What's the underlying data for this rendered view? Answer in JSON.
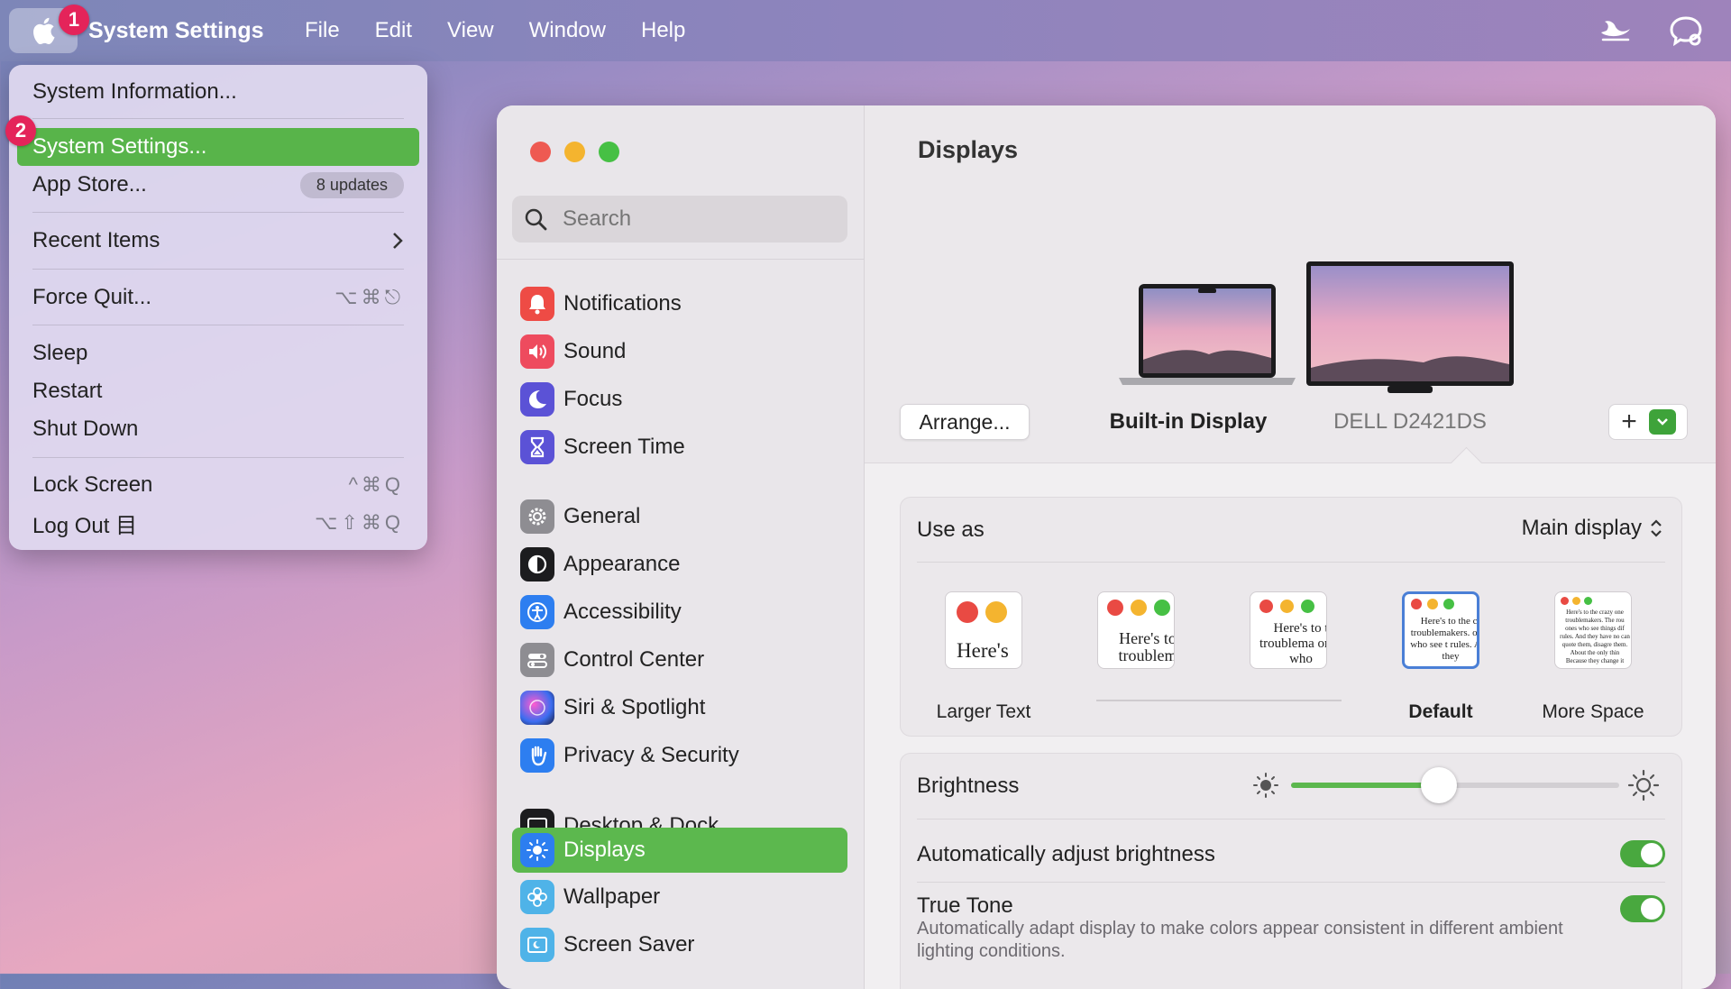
{
  "menubar": {
    "app_name": "System Settings",
    "menus": [
      "File",
      "Edit",
      "View",
      "Window",
      "Help"
    ]
  },
  "badges": {
    "apple": "1",
    "settings": "2"
  },
  "apple_menu": {
    "system_information": "System Information...",
    "system_settings": "System Settings...",
    "app_store": "App Store...",
    "app_store_badge": "8 updates",
    "recent_items": "Recent Items",
    "force_quit": "Force Quit...",
    "force_quit_shortcut": "⌥⌘⎋",
    "sleep": "Sleep",
    "restart": "Restart",
    "shut_down": "Shut Down",
    "lock_screen": "Lock Screen",
    "lock_screen_shortcut": "^⌘Q",
    "log_out": "Log Out 目",
    "log_out_shortcut": "⌥⇧⌘Q"
  },
  "sidebar": {
    "search_placeholder": "Search",
    "items": [
      {
        "label": "Notifications",
        "icon": "bell-icon",
        "color": "#ee4b45"
      },
      {
        "label": "Sound",
        "icon": "speaker-icon",
        "color": "#ee4b5e"
      },
      {
        "label": "Focus",
        "icon": "moon-icon",
        "color": "#5b52d6"
      },
      {
        "label": "Screen Time",
        "icon": "hourglass-icon",
        "color": "#5b52d6"
      },
      {
        "label": "General",
        "icon": "gear-icon",
        "color": "#8e8d92"
      },
      {
        "label": "Appearance",
        "icon": "appearance-icon",
        "color": "#1c1c1e"
      },
      {
        "label": "Accessibility",
        "icon": "accessibility-icon",
        "color": "#2d7ef0"
      },
      {
        "label": "Control Center",
        "icon": "control-center-icon",
        "color": "#8e8d92"
      },
      {
        "label": "Siri & Spotlight",
        "icon": "siri-icon",
        "color": "#7a3bd1"
      },
      {
        "label": "Privacy & Security",
        "icon": "hand-icon",
        "color": "#2d7ef0"
      },
      {
        "label": "Desktop & Dock",
        "icon": "dock-icon",
        "color": "#1c1c1e"
      },
      {
        "label": "Displays",
        "icon": "sun-icon",
        "color": "#2d7ef0"
      },
      {
        "label": "Wallpaper",
        "icon": "flower-icon",
        "color": "#4fb3e8"
      },
      {
        "label": "Screen Saver",
        "icon": "screen-saver-icon",
        "color": "#4fb3e8"
      }
    ]
  },
  "displays": {
    "title": "Displays",
    "arrange_label": "Arrange...",
    "builtin_label": "Built-in Display",
    "external_label": "DELL D2421DS",
    "add_label": "+",
    "use_as_label": "Use as",
    "use_as_value": "Main display",
    "resolutions": [
      {
        "label": "Larger Text",
        "sample": "Here's"
      },
      {
        "label": "",
        "sample": "Here's to troublem"
      },
      {
        "label": "",
        "sample": "Here's to t troublema ones who"
      },
      {
        "label": "Default",
        "sample": "Here's to the cr troublemakers. ones who see t rules. And they"
      },
      {
        "label": "More Space",
        "sample": "Here's to the crazy one troublemakers. The rou ones who see things dif rules. And they have no can quote them, disagre them. About the only thin Because they change it"
      }
    ],
    "brightness_label": "Brightness",
    "brightness_level": 0.45,
    "auto_brightness_label": "Automatically adjust brightness",
    "auto_brightness_on": true,
    "true_tone_label": "True Tone",
    "true_tone_on": true,
    "true_tone_desc": "Automatically adapt display to make colors appear consistent in different ambient lighting conditions."
  }
}
